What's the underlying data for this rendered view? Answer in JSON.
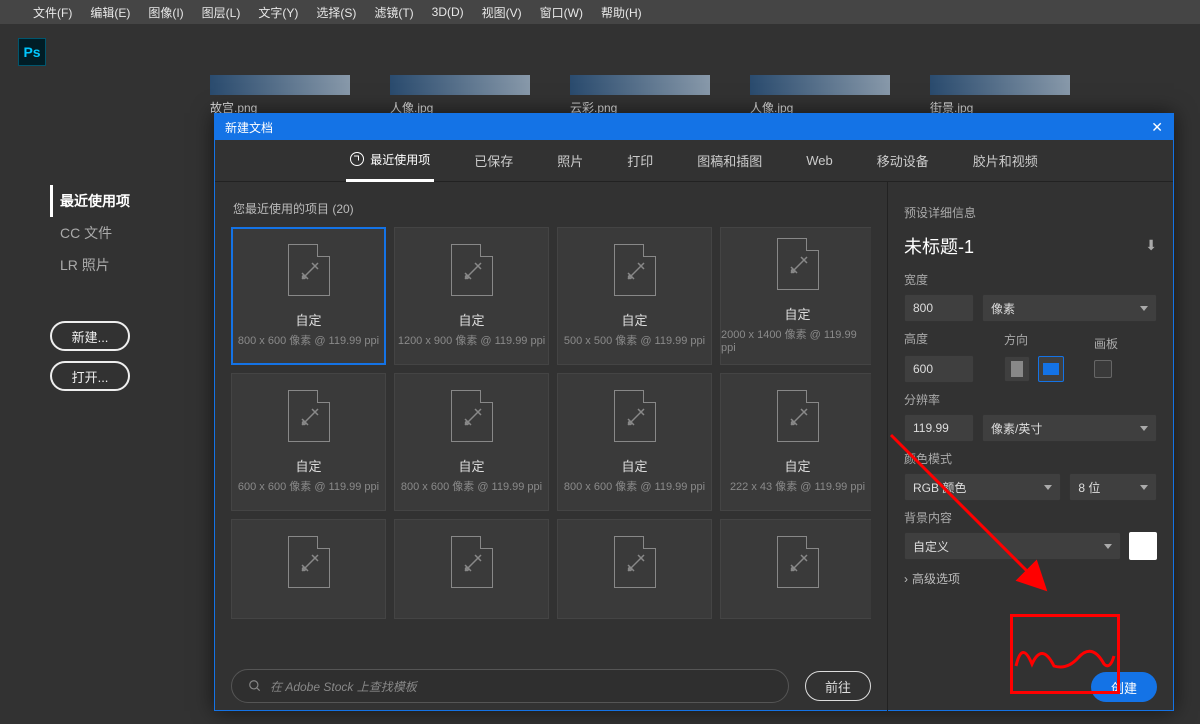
{
  "menubar": [
    "文件(F)",
    "编辑(E)",
    "图像(I)",
    "图层(L)",
    "文字(Y)",
    "选择(S)",
    "滤镜(T)",
    "3D(D)",
    "视图(V)",
    "窗口(W)",
    "帮助(H)"
  ],
  "ps_badge": "Ps",
  "home_thumbs": [
    "故宫.png",
    "人像.jpg",
    "云彩.png",
    "人像.jpg",
    "街景.jpg"
  ],
  "left_nav": {
    "items": [
      "最近使用项",
      "CC 文件",
      "LR 照片"
    ],
    "active": 0,
    "newBtn": "新建...",
    "openBtn": "打开..."
  },
  "dialog": {
    "title": "新建文档",
    "tabs": [
      "最近使用项",
      "已保存",
      "照片",
      "打印",
      "图稿和插图",
      "Web",
      "移动设备",
      "胶片和视频"
    ],
    "activeTab": 0,
    "recentHead": "您最近使用的项目 (20)",
    "searchPlaceholder": "在 Adobe Stock 上查找模板",
    "goLabel": "前往",
    "presets": [
      {
        "title": "自定",
        "sub": "800 x 600 像素 @ 119.99 ppi",
        "selected": true
      },
      {
        "title": "自定",
        "sub": "1200 x 900 像素 @ 119.99 ppi"
      },
      {
        "title": "自定",
        "sub": "500 x 500 像素 @ 119.99 ppi"
      },
      {
        "title": "自定",
        "sub": "2000 x 1400 像素 @ 119.99 ppi"
      },
      {
        "title": "自定",
        "sub": "600 x 600 像素 @ 119.99 ppi"
      },
      {
        "title": "自定",
        "sub": "800 x 600 像素 @ 119.99 ppi"
      },
      {
        "title": "自定",
        "sub": "800 x 600 像素 @ 119.99 ppi"
      },
      {
        "title": "自定",
        "sub": "222 x 43 像素 @ 119.99 ppi"
      },
      {
        "title": "",
        "sub": ""
      },
      {
        "title": "",
        "sub": ""
      },
      {
        "title": "",
        "sub": ""
      },
      {
        "title": "",
        "sub": ""
      }
    ]
  },
  "details": {
    "headLabel": "预设详细信息",
    "title": "未标题-1",
    "widthLabel": "宽度",
    "widthVal": "800",
    "widthUnit": "像素",
    "heightLabel": "高度",
    "heightVal": "600",
    "orientLabel": "方向",
    "artboardLabel": "画板",
    "resLabel": "分辨率",
    "resVal": "119.99",
    "resUnit": "像素/英寸",
    "colorLabel": "颜色模式",
    "colorMode": "RGB 颜色",
    "colorDepth": "8 位",
    "bgLabel": "背景内容",
    "bgValue": "自定义",
    "advLabel": "高级选项",
    "createBtn": "创建"
  }
}
